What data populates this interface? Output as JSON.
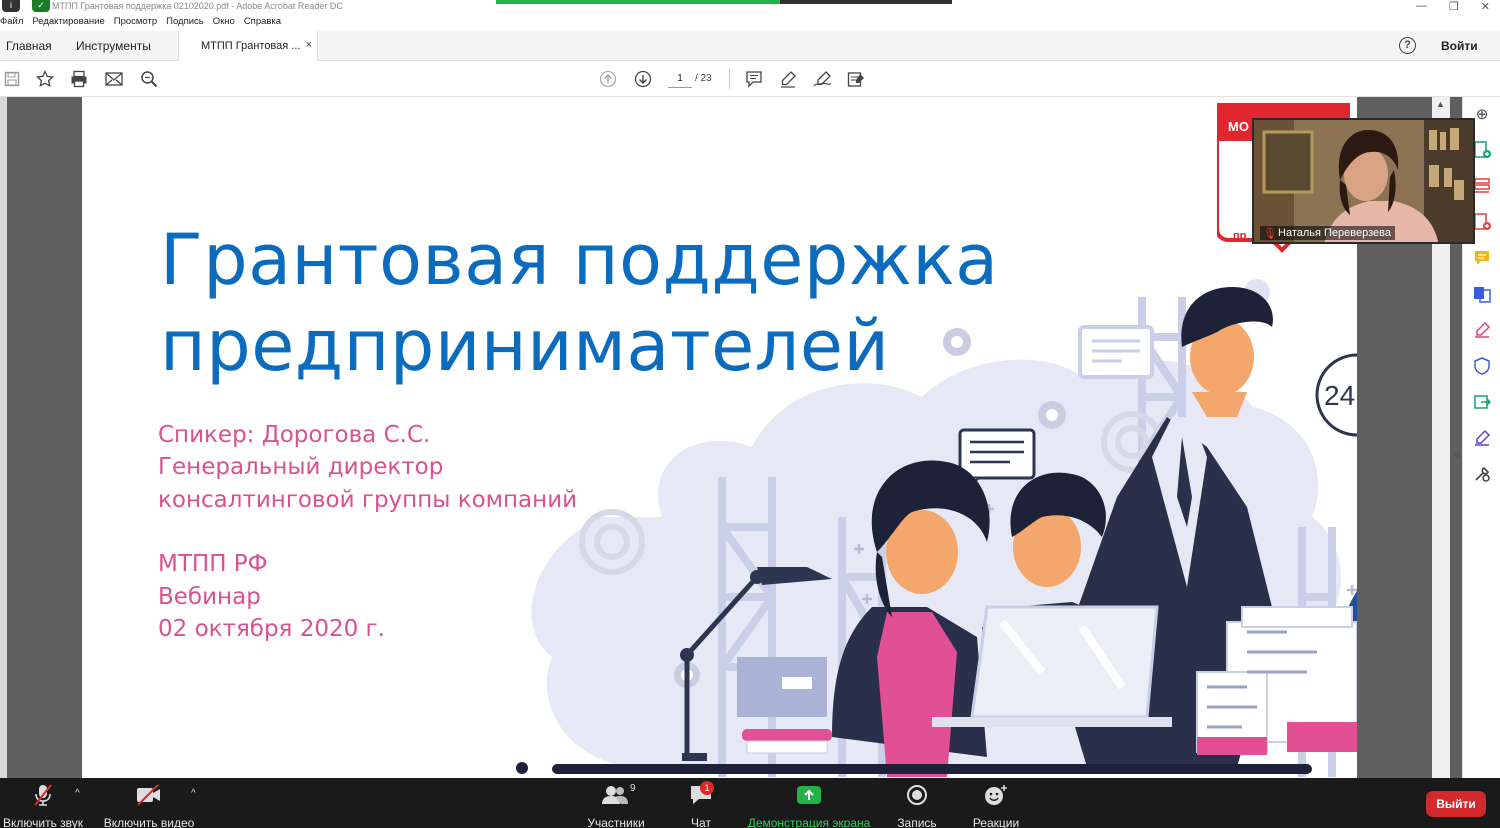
{
  "window": {
    "title": "МТПП Грантовая поддержка 02102020.pdf - Adobe Acrobat Reader DC"
  },
  "menu": [
    "Файл",
    "Редактирование",
    "Просмотр",
    "Подпись",
    "Окно",
    "Справка"
  ],
  "tabs": {
    "home": "Главная",
    "tools": "Инструменты",
    "document": "МТПП Грантовая ...",
    "close": "×",
    "help": "?",
    "signin": "Войти"
  },
  "toolbar": {
    "page_current": "1",
    "page_total": "/ 23",
    "icons": [
      "save-icon",
      "bookmark-star-icon",
      "print-icon",
      "email-icon",
      "search-icon",
      "page-up-icon",
      "page-down-icon",
      "comment-icon",
      "highlight-pen-icon",
      "sign-icon",
      "fill-sign-icon"
    ]
  },
  "slide": {
    "title_line1": "Грантовая поддержка",
    "title_line2": "предпринимателей",
    "speaker": "Спикер: Дорогова С.С.",
    "role": "Генеральный директор",
    "org": "консалтинговой группы компаний",
    "chamber": "МТПП РФ",
    "event": "Вебинар",
    "date": "02 октября 2020 г.",
    "badge_24": "24",
    "logo_partial": "МО",
    "logo_partial2": "пр"
  },
  "video": {
    "participant_name": "Наталья Переверзева",
    "muted": true
  },
  "zoom": {
    "unmute": "Включить звук",
    "start_video": "Включить видео",
    "participants": "Участники",
    "participants_count": "9",
    "chat": "Чат",
    "chat_badge": "1",
    "share": "Демонстрация экрана",
    "record": "Запись",
    "reactions": "Реакции",
    "leave": "Выйти"
  },
  "colors": {
    "title_blue": "#0b6bbd",
    "pink": "#d9518f",
    "share_green": "#24b34a",
    "leave_red": "#d12b2e"
  }
}
